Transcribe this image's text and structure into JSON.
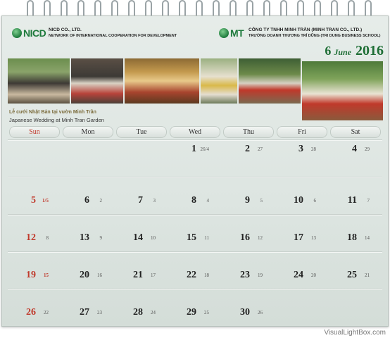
{
  "header": {
    "left_logo": "NICD",
    "left_org_line1": "NICD CO., LTD.",
    "left_org_line2": "NETWORK OF INTERNATIONAL COOPERATION FOR DEVELOPMENT",
    "right_logo": "MT",
    "right_org_line1": "CÔNG TY TNHH MINH TRẦN (MINH TRAN CO., LTD.)",
    "right_org_line2": "TRƯỜNG DOANH THƯƠNG TRÍ DŨNG (TRI DUNG BUSINESS SCHOOL)"
  },
  "date": {
    "day": "6",
    "month": "June",
    "year": "2016"
  },
  "caption": {
    "vi": "Lễ cưới Nhật Bản tại vườn Minh Trần",
    "en": "Japanese Wedding at Minh Tran Garden"
  },
  "weekdays": [
    "Sun",
    "Mon",
    "Tue",
    "Wed",
    "Thu",
    "Fri",
    "Sat"
  ],
  "weeks": [
    [
      [
        "",
        ""
      ],
      [
        "",
        ""
      ],
      [
        "",
        ""
      ],
      [
        "1",
        "26/4"
      ],
      [
        "2",
        "27"
      ],
      [
        "3",
        "28"
      ],
      [
        "4",
        "29"
      ]
    ],
    [
      [
        "5",
        "1/5"
      ],
      [
        "6",
        "2"
      ],
      [
        "7",
        "3"
      ],
      [
        "8",
        "4"
      ],
      [
        "9",
        "5"
      ],
      [
        "10",
        "6"
      ],
      [
        "11",
        "7"
      ]
    ],
    [
      [
        "12",
        "8"
      ],
      [
        "13",
        "9"
      ],
      [
        "14",
        "10"
      ],
      [
        "15",
        "11"
      ],
      [
        "16",
        "12"
      ],
      [
        "17",
        "13"
      ],
      [
        "18",
        "14"
      ]
    ],
    [
      [
        "19",
        "15"
      ],
      [
        "20",
        "16"
      ],
      [
        "21",
        "17"
      ],
      [
        "22",
        "18"
      ],
      [
        "23",
        "19"
      ],
      [
        "24",
        "20"
      ],
      [
        "25",
        "21"
      ]
    ],
    [
      [
        "26",
        "22"
      ],
      [
        "27",
        "23"
      ],
      [
        "28",
        "24"
      ],
      [
        "29",
        "25"
      ],
      [
        "30",
        "26"
      ],
      [
        "",
        ""
      ],
      [
        "",
        ""
      ]
    ]
  ],
  "watermark": "VisualLightBox.com",
  "colors": {
    "accent": "#1e6e35",
    "sunday": "#c0392b"
  }
}
